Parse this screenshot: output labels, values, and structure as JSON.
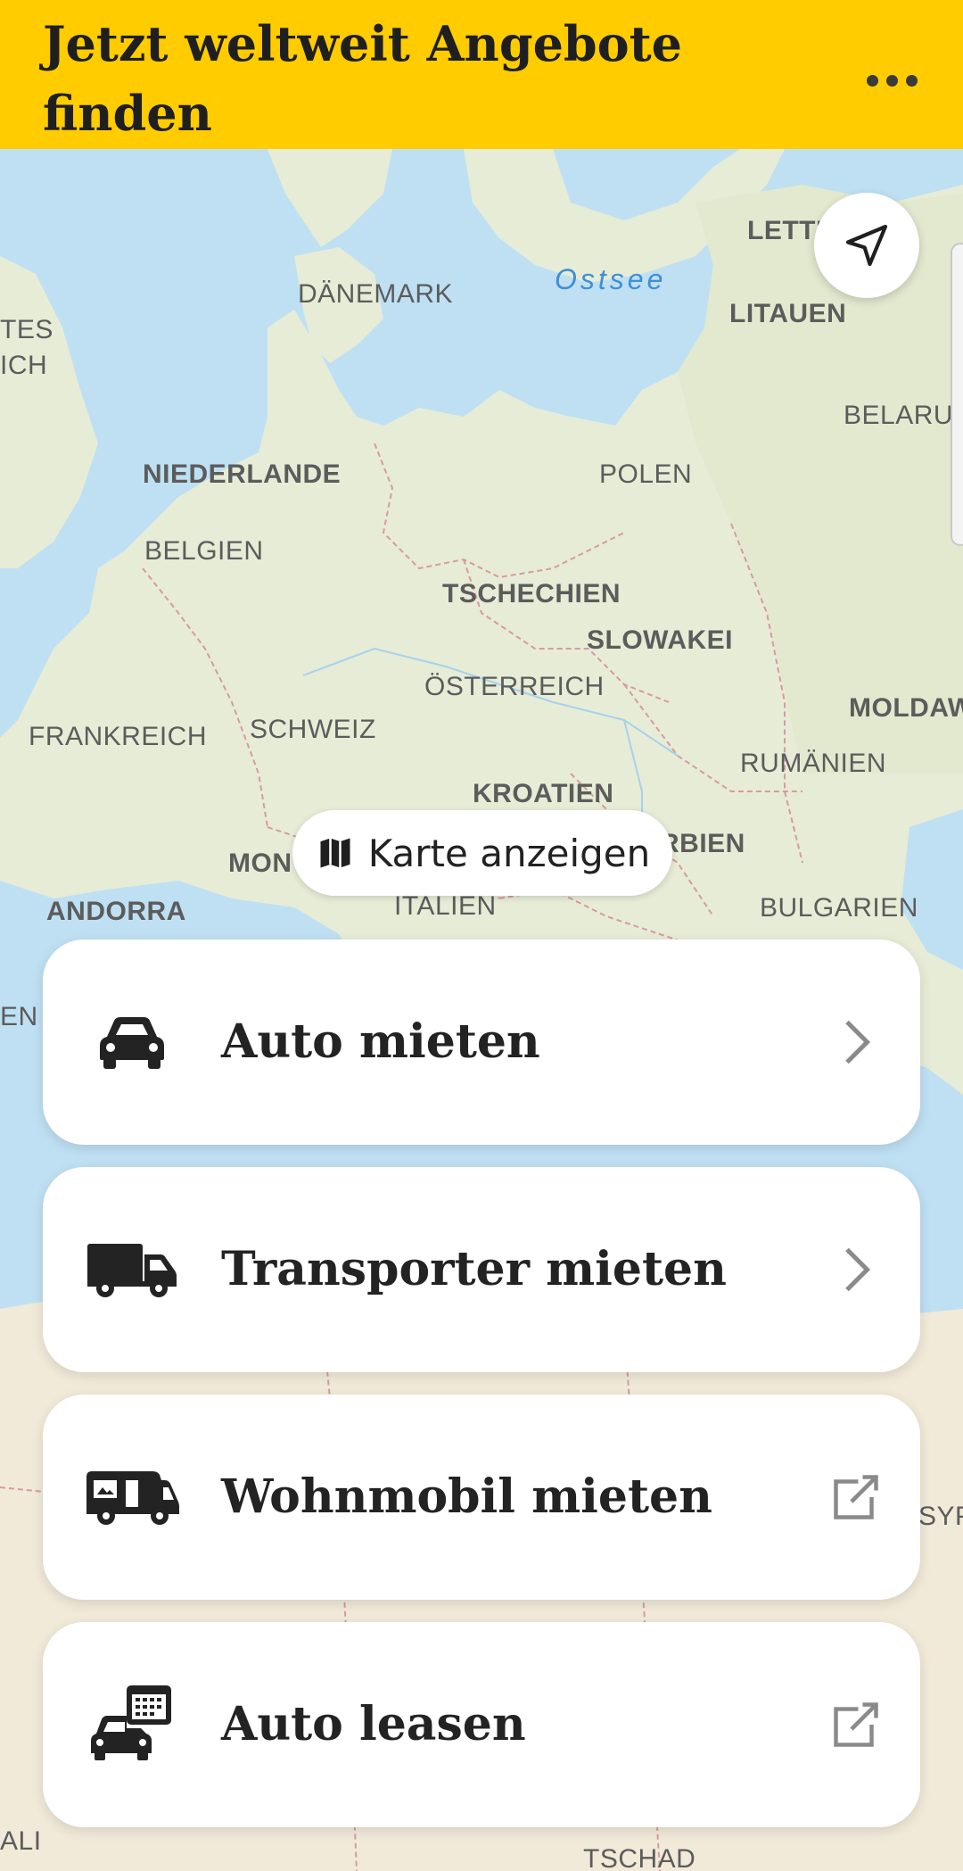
{
  "header": {
    "title": "Jetzt weltweit Angebote finden",
    "more_icon": "more-horizontal-icon"
  },
  "map": {
    "labels": {
      "lettland": "LETTL",
      "ostsee": "Ostsee",
      "daenemark": "DÄNEMARK",
      "litauen": "LITAUEN",
      "vereinigtes1": "TES",
      "vereinigtes2": "ICH",
      "belarus": "BELARUS",
      "niederlande": "NIEDERLANDE",
      "polen": "POLEN",
      "belgien": "BELGIEN",
      "tschechien": "TSCHECHIEN",
      "slowakei": "SLOWAKEI",
      "oesterreich": "ÖSTERREICH",
      "moldawien": "MOLDAW",
      "frankreich": "FRANKREICH",
      "schweiz": "SCHWEIZ",
      "rumaenien": "RUMÄNIEN",
      "kroatien": "KROATIEN",
      "monaco": "MON",
      "serbien": "RBIEN",
      "andorra": "ANDORRA",
      "italien": "ITALIEN",
      "bulgarien": "BULGARIEN",
      "spanien": "EN",
      "aegypten": "SYP",
      "libyen": "ALI",
      "tschad": "TSCHAD"
    },
    "locate_icon": "navigation-arrow-icon",
    "show_map_button": {
      "label": "Karte anzeigen",
      "icon": "map-icon"
    }
  },
  "services": [
    {
      "label": "Auto mieten",
      "icon": "car-icon",
      "action_icon": "chevron-right-icon"
    },
    {
      "label": "Transporter mieten",
      "icon": "truck-icon",
      "action_icon": "chevron-right-icon"
    },
    {
      "label": "Wohnmobil mieten",
      "icon": "camper-icon",
      "action_icon": "external-link-icon"
    },
    {
      "label": "Auto leasen",
      "icon": "car-leasing-icon",
      "action_icon": "external-link-icon"
    }
  ],
  "colors": {
    "brand_yellow": "#ffcc00",
    "water": "#bfe0f3",
    "land": "#e9edd9"
  }
}
